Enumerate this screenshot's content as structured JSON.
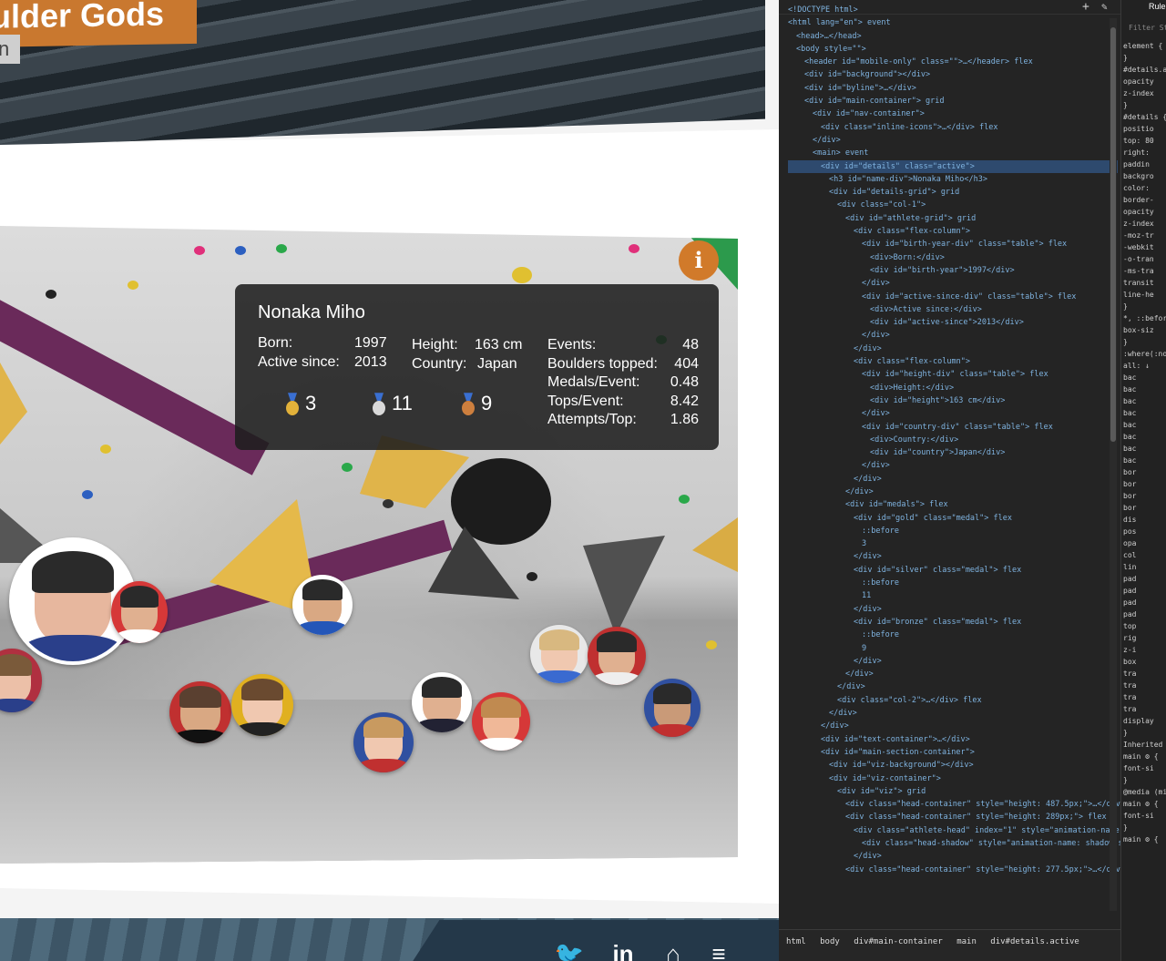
{
  "site": {
    "title": "ulder Gods",
    "subtitle_fragment": "n",
    "info_button": "i",
    "details": {
      "name": "Nonaka Miho",
      "born_label": "Born:",
      "born_value": "1997",
      "active_label": "Active since:",
      "active_value": "2013",
      "height_label": "Height:",
      "height_value": "163 cm",
      "country_label": "Country:",
      "country_value": "Japan",
      "medals": {
        "gold": "3",
        "silver": "11",
        "bronze": "9"
      },
      "stats": [
        {
          "label": "Events:",
          "value": "48"
        },
        {
          "label": "Boulders topped:",
          "value": "404"
        },
        {
          "label": "Medals/Event:",
          "value": "0.48"
        },
        {
          "label": "Tops/Event:",
          "value": "8.42"
        },
        {
          "label": "Attempts/Top:",
          "value": "1.86"
        }
      ]
    },
    "social_icons": [
      "twitter-icon",
      "linkedin-icon",
      "github-icon",
      "stackoverflow-icon"
    ],
    "social_glyphs": [
      "🐦",
      "in",
      "⌂",
      "≡"
    ]
  },
  "devtools": {
    "tree": [
      "<!DOCTYPE html>",
      "<html lang=\"en\"> event",
      "<head>…</head>",
      "<body style=\"\">",
      "<header id=\"mobile-only\" class=\"\">…</header> flex",
      "<div id=\"background\"></div>",
      "<div id=\"byline\">…</div>",
      "<div id=\"main-container\"> grid",
      "<div id=\"nav-container\">",
      "<div class=\"inline-icons\">…</div> flex",
      "</div>",
      "<main> event",
      "<div id=\"details\" class=\"active\">",
      "<h3 id=\"name-div\">Nonaka Miho</h3>",
      "<div id=\"details-grid\"> grid",
      "<div class=\"col-1\">",
      "<div id=\"athlete-grid\"> grid",
      "<div class=\"flex-column\">",
      "<div id=\"birth-year-div\" class=\"table\"> flex",
      "<div>Born:</div>",
      "<div id=\"birth-year\">1997</div>",
      "</div>",
      "<div id=\"active-since-div\" class=\"table\"> flex",
      "<div>Active since:</div>",
      "<div id=\"active-since\">2013</div>",
      "</div>",
      "</div>",
      "<div class=\"flex-column\">",
      "<div id=\"height-div\" class=\"table\"> flex",
      "<div>Height:</div>",
      "<div id=\"height\">163 cm</div>",
      "</div>",
      "<div id=\"country-div\" class=\"table\"> flex",
      "<div>Country:</div>",
      "<div id=\"country\">Japan</div>",
      "</div>",
      "</div>",
      "</div>",
      "<div id=\"medals\"> flex",
      "<div id=\"gold\" class=\"medal\"> flex",
      "::before",
      "3",
      "</div>",
      "<div id=\"silver\" class=\"medal\"> flex",
      "::before",
      "11",
      "</div>",
      "<div id=\"bronze\" class=\"medal\"> flex",
      "::before",
      "9",
      "</div>",
      "</div>",
      "</div>",
      "<div class=\"col-2\">…</div> flex",
      "</div>",
      "</div>",
      "<div id=\"text-container\">…</div>",
      "<div id=\"main-section-container\">",
      "<div id=\"viz-background\"></div>",
      "<div id=\"viz-container\">",
      "<div id=\"viz\"> grid",
      "<div class=\"head-container\" style=\"height: 487.5px;\">…</div> flex",
      "<div class=\"head-container\" style=\"height: 289px;\"> flex",
      "<div class=\"athlete-head\" index=\"1\" style=\"animation-name: fall-1; animation-duration: 0.8704s;\">…</div> event flex",
      "<div class=\"head-shadow\" style=\"animation-name: shadow-shrink-1; animation-duration: 0.8704s;\"></div>",
      "</div>",
      "<div class=\"head-container\" style=\"height: 277.5px;\">…</div> flex"
    ],
    "breadcrumb": [
      "html",
      "body",
      "div#main-container",
      "main",
      "div#details.active"
    ],
    "styles_tab": "Rule",
    "filter_placeholder": "Filter Sty",
    "styles_lines": [
      "element {",
      "}",
      "#details.a",
      "opacity",
      "z-index",
      "}",
      "#details {",
      "positio",
      "top: 80",
      "right:",
      "paddin",
      "backgro",
      "color:",
      "border-",
      "opacity",
      "z-index",
      "-moz-tr",
      "-webkit",
      "-o-tran",
      "-ms-tra",
      "transit",
      "line-he",
      "}",
      "*, ::befor",
      "box-siz",
      "}",
      ":where(:not",
      "all: ↓",
      "bac",
      "bac",
      "bac",
      "bac",
      "bac",
      "bac",
      "bac",
      "bac",
      "bor",
      "bor",
      "bor",
      "bor",
      "dis",
      "pos",
      "opa",
      "col",
      "lin",
      "pad",
      "pad",
      "pad",
      "pad",
      "top",
      "rig",
      "z-i",
      "box",
      "tra",
      "tra",
      "tra",
      "tra",
      "display",
      "}",
      "Inherited fr",
      "main ⚙ {",
      "font-si",
      "}",
      "@media (min",
      "main ⚙ {",
      "font-si",
      "}",
      "main ⚙ {"
    ]
  }
}
